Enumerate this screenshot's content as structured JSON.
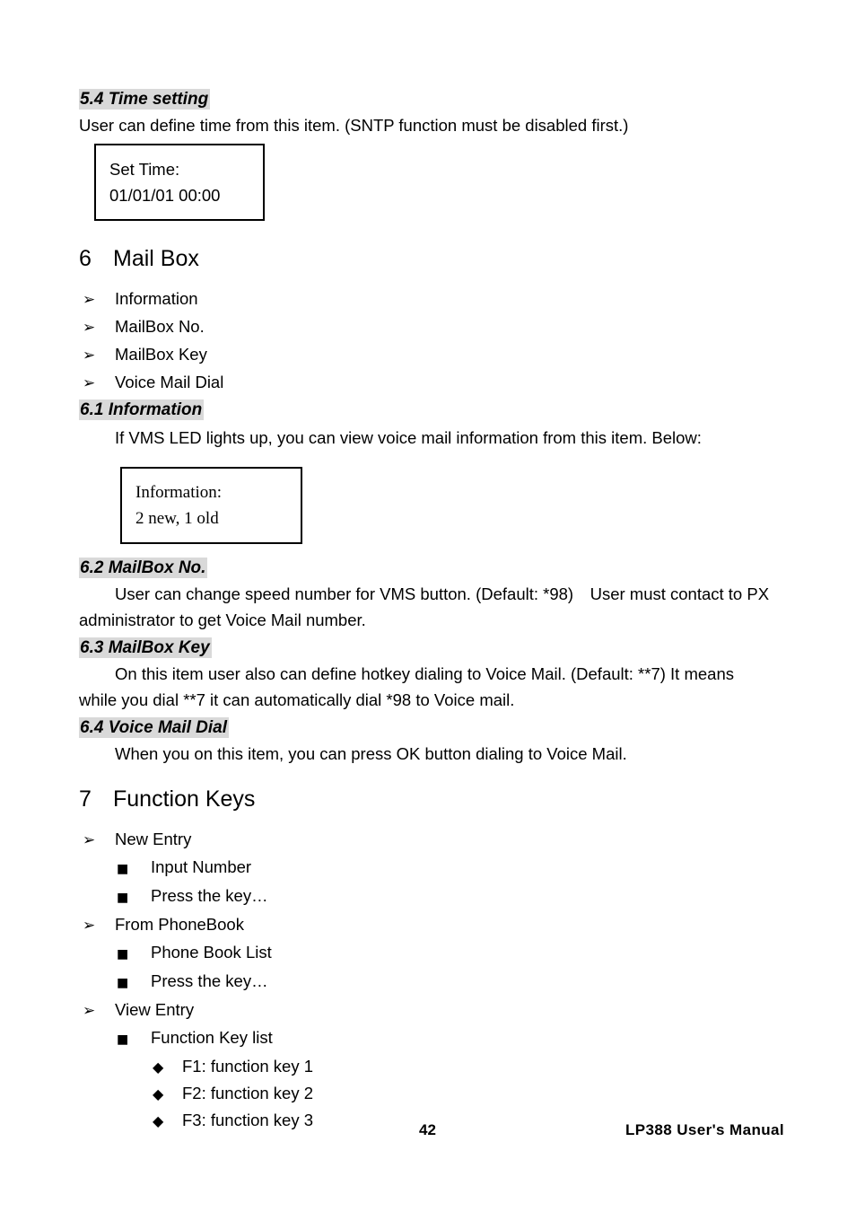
{
  "document": {
    "footer": {
      "page_number": "42",
      "manual_title": "LP388 User's Manual"
    }
  },
  "sections": {
    "time_setting": {
      "heading": "5.4 Time setting",
      "body": "User can define time from this item. (SNTP function must be disabled first.)",
      "lcd": {
        "line1": "Set Time:",
        "line2": "01/01/01 00:00"
      }
    },
    "mail_box": {
      "number": "6",
      "title": "Mail Box",
      "items": [
        {
          "bullet": "➢",
          "label": "Information"
        },
        {
          "bullet": "➢",
          "label": "MailBox No."
        },
        {
          "bullet": "➢",
          "label": "MailBox Key"
        },
        {
          "bullet": "➢",
          "label": "Voice Mail Dial"
        }
      ]
    },
    "information": {
      "heading": "6.1 Information",
      "body": "If VMS LED lights up, you can view voice mail information from this item. Below:",
      "lcd": {
        "line1": "Information:",
        "line2": "2 new, 1 old"
      }
    },
    "mailbox_no": {
      "heading": "6.2 MailBox No.",
      "body": "User can change speed number for VMS button. (Default: *98) User must contact to PX administrator to get Voice Mail number."
    },
    "mailbox_key": {
      "heading": "6.3 MailBox Key",
      "body": "On this item user also can define hotkey dialing to Voice Mail. (Default: **7) It means while you dial **7 it can automatically dial *98 to Voice mail."
    },
    "voice_mail_dial": {
      "heading": "6.4 Voice Mail Dial",
      "body": "When you on this item, you can press OK button dialing to Voice Mail."
    },
    "function_keys": {
      "number": "7",
      "title": "Function Keys",
      "items": [
        {
          "bullet": "➢",
          "label": "New Entry",
          "level": 1
        },
        {
          "bullet": "■",
          "label": "Input Number",
          "level": 2
        },
        {
          "bullet": "■",
          "label": "Press the key…",
          "level": 2
        },
        {
          "bullet": "➢",
          "label": "From PhoneBook",
          "level": 1
        },
        {
          "bullet": "■",
          "label": "Phone Book List",
          "level": 2
        },
        {
          "bullet": "■",
          "label": "Press the key…",
          "level": 2
        },
        {
          "bullet": "➢",
          "label": "View Entry",
          "level": 1
        },
        {
          "bullet": "■",
          "label": "Function Key list",
          "level": 2
        },
        {
          "bullet": "◆",
          "label": "F1: function key 1",
          "level": 3
        },
        {
          "bullet": "◆",
          "label": "F2: function key 2",
          "level": 3
        },
        {
          "bullet": "◆",
          "label": "F3: function key 3",
          "level": 3
        }
      ]
    }
  },
  "colors": {
    "heading_highlight": "#d9d9d9",
    "text": "#000000",
    "page_background": "#ffffff",
    "box_border": "#000000"
  }
}
